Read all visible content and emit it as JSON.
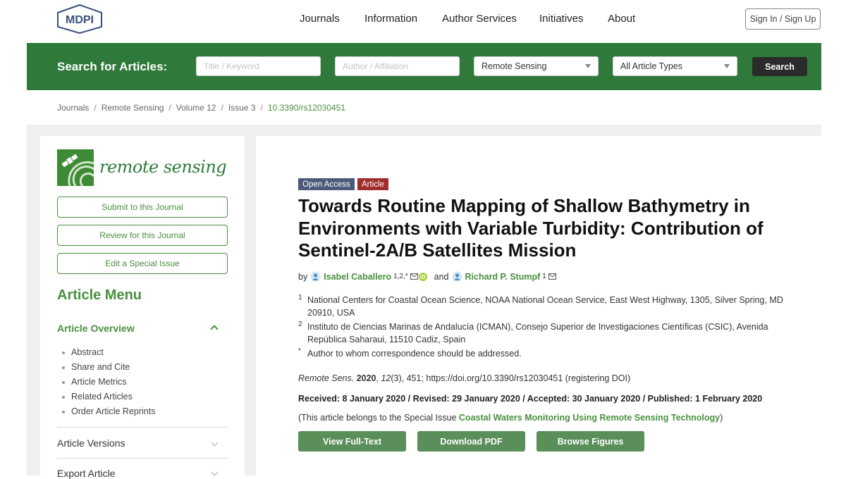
{
  "brand": {
    "logo_text": "MDPI",
    "accent": "#2f7a3b",
    "link": "#4a8f3f"
  },
  "nav": {
    "items": [
      "Journals",
      "Information",
      "Author Services",
      "Initiatives",
      "About"
    ],
    "signin": "Sign In / Sign Up"
  },
  "search": {
    "label": "Search for Articles:",
    "title_placeholder": "Title / Keyword",
    "author_placeholder": "Author / Affiliation",
    "journal_selected": "Remote Sensing",
    "type_selected": "All Article Types",
    "button": "Search"
  },
  "breadcrumb": [
    "Journals",
    "Remote Sensing",
    "Volume 12",
    "Issue 3",
    "10.3390/rs12030451"
  ],
  "sidebar": {
    "journal_name": "remote sensing",
    "buttons": [
      "Submit to this Journal",
      "Review for this Journal",
      "Edit a Special Issue"
    ],
    "menu_title": "Article Menu",
    "overview_title": "Article Overview",
    "overview_items": [
      "Abstract",
      "Share and Cite",
      "Article Metrics",
      "Related Articles",
      "Order Article Reprints"
    ],
    "versions": "Article Versions",
    "export": "Export Article"
  },
  "article": {
    "badge_open_access": "Open Access",
    "badge_type": "Article",
    "title": "Towards Routine Mapping of Shallow Bathymetry in Environments with Variable Turbidity: Contribution of Sentinel-2A/B Satellites Mission",
    "by": "by",
    "author1": {
      "name": "Isabel Caballero",
      "sup": "1,2,*"
    },
    "and": "and",
    "author2": {
      "name": "Richard P. Stumpf",
      "sup": "1"
    },
    "affiliations": [
      {
        "num": "1",
        "text": "National Centers for Coastal Ocean Science, NOAA National Ocean Service, East West Highway, 1305, Silver Spring, MD 20910, USA"
      },
      {
        "num": "2",
        "text": "Instituto de Ciencias Marinas de Andalucía (ICMAN), Consejo Superior de Investigaciones Científicas (CSIC), Avenida República Saharaui, 11510 Cadiz, Spain"
      },
      {
        "num": "*",
        "text": "Author to whom correspondence should be addressed."
      }
    ],
    "citation": {
      "journal": "Remote Sens.",
      "year": "2020",
      "volume": "12",
      "rest": "(3), 451; https://doi.org/10.3390/rs12030451 (registering DOI)"
    },
    "dates": "Received: 8 January 2020 / Revised: 29 January 2020 / Accepted: 30 January 2020 / Published: 1 February 2020",
    "special_prefix": "(This article belongs to the Special Issue ",
    "special_issue": "Coastal Waters Monitoring Using Remote Sensing Technology",
    "special_suffix": ")",
    "actions": [
      "View Full-Text",
      "Download PDF",
      "Browse Figures"
    ]
  }
}
